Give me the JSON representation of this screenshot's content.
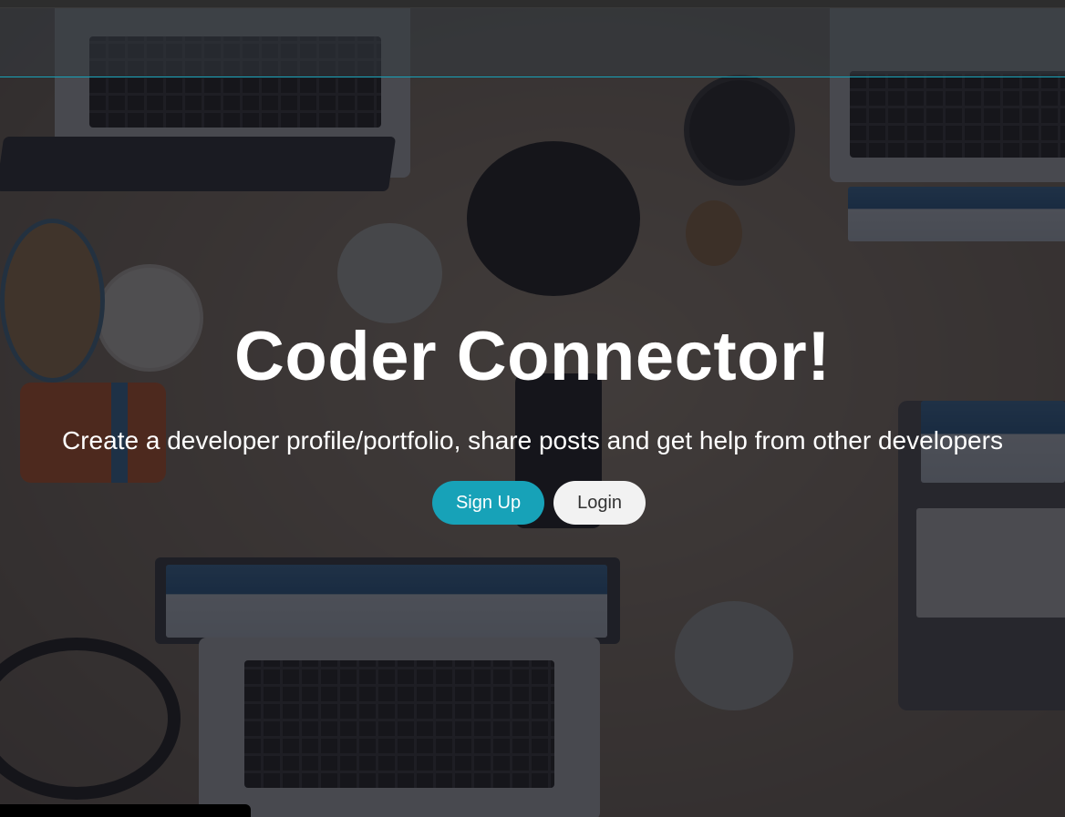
{
  "hero": {
    "title": "Coder Connector!",
    "lead": "Create a developer profile/portfolio, share posts and get help from other developers"
  },
  "buttons": {
    "signup_label": "Sign Up",
    "login_label": "Login"
  },
  "colors": {
    "accent": "#17a2b8",
    "light_button": "#f2f2f2",
    "overlay": "rgba(20,20,26,0.72)"
  }
}
